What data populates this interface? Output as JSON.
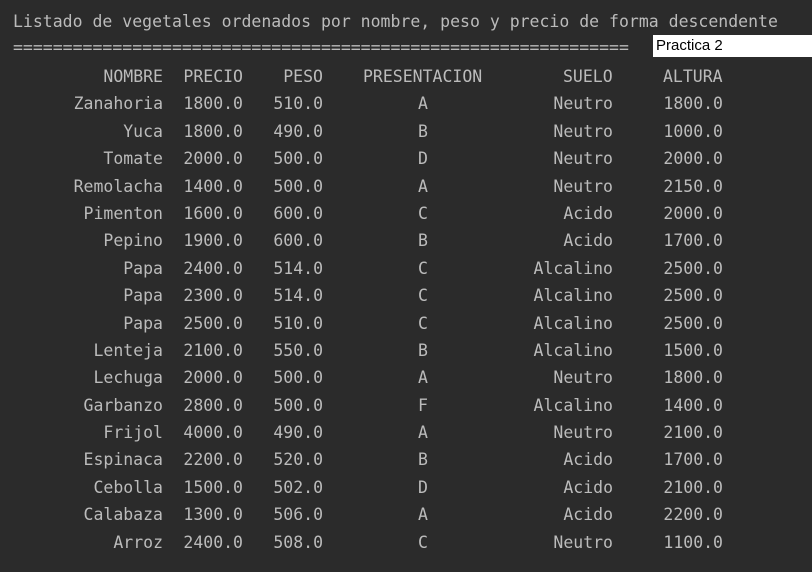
{
  "console": {
    "title": "Listado de vegetales ordenados por nombre, peso y precio de forma descendente",
    "separator": "==============================================================",
    "tag": "Practica 2"
  },
  "table": {
    "headers": {
      "nombre": "NOMBRE",
      "precio": "PRECIO",
      "peso": "PESO",
      "presentacion": "PRESENTACION",
      "suelo": "SUELO",
      "altura": "ALTURA"
    },
    "rows": [
      {
        "nombre": "Zanahoria",
        "precio": "1800.0",
        "peso": "510.0",
        "presentacion": "A",
        "suelo": "Neutro",
        "altura": "1800.0"
      },
      {
        "nombre": "Yuca",
        "precio": "1800.0",
        "peso": "490.0",
        "presentacion": "B",
        "suelo": "Neutro",
        "altura": "1000.0"
      },
      {
        "nombre": "Tomate",
        "precio": "2000.0",
        "peso": "500.0",
        "presentacion": "D",
        "suelo": "Neutro",
        "altura": "2000.0"
      },
      {
        "nombre": "Remolacha",
        "precio": "1400.0",
        "peso": "500.0",
        "presentacion": "A",
        "suelo": "Neutro",
        "altura": "2150.0"
      },
      {
        "nombre": "Pimenton",
        "precio": "1600.0",
        "peso": "600.0",
        "presentacion": "C",
        "suelo": "Acido",
        "altura": "2000.0"
      },
      {
        "nombre": "Pepino",
        "precio": "1900.0",
        "peso": "600.0",
        "presentacion": "B",
        "suelo": "Acido",
        "altura": "1700.0"
      },
      {
        "nombre": "Papa",
        "precio": "2400.0",
        "peso": "514.0",
        "presentacion": "C",
        "suelo": "Alcalino",
        "altura": "2500.0"
      },
      {
        "nombre": "Papa",
        "precio": "2300.0",
        "peso": "514.0",
        "presentacion": "C",
        "suelo": "Alcalino",
        "altura": "2500.0"
      },
      {
        "nombre": "Papa",
        "precio": "2500.0",
        "peso": "510.0",
        "presentacion": "C",
        "suelo": "Alcalino",
        "altura": "2500.0"
      },
      {
        "nombre": "Lenteja",
        "precio": "2100.0",
        "peso": "550.0",
        "presentacion": "B",
        "suelo": "Alcalino",
        "altura": "1500.0"
      },
      {
        "nombre": "Lechuga",
        "precio": "2000.0",
        "peso": "500.0",
        "presentacion": "A",
        "suelo": "Neutro",
        "altura": "1800.0"
      },
      {
        "nombre": "Garbanzo",
        "precio": "2800.0",
        "peso": "500.0",
        "presentacion": "F",
        "suelo": "Alcalino",
        "altura": "1400.0"
      },
      {
        "nombre": "Frijol",
        "precio": "4000.0",
        "peso": "490.0",
        "presentacion": "A",
        "suelo": "Neutro",
        "altura": "2100.0"
      },
      {
        "nombre": "Espinaca",
        "precio": "2200.0",
        "peso": "520.0",
        "presentacion": "B",
        "suelo": "Acido",
        "altura": "1700.0"
      },
      {
        "nombre": "Cebolla",
        "precio": "1500.0",
        "peso": "502.0",
        "presentacion": "D",
        "suelo": "Acido",
        "altura": "2100.0"
      },
      {
        "nombre": "Calabaza",
        "precio": "1300.0",
        "peso": "506.0",
        "presentacion": "A",
        "suelo": "Acido",
        "altura": "2200.0"
      },
      {
        "nombre": "Arroz",
        "precio": "2400.0",
        "peso": "508.0",
        "presentacion": "C",
        "suelo": "Neutro",
        "altura": "1100.0"
      }
    ]
  },
  "colors": {
    "background": "#2b2b2b",
    "text": "#bbbbbb",
    "tag_background": "#ffffff",
    "tag_text": "#000000"
  }
}
